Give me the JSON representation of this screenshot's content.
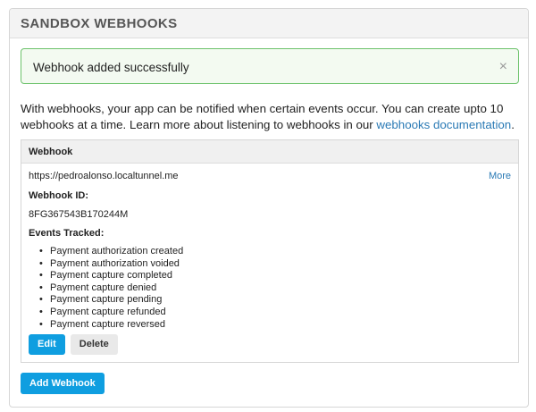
{
  "panel": {
    "title": "SANDBOX WEBHOOKS"
  },
  "alert": {
    "message": "Webhook added successfully",
    "close_glyph": "×"
  },
  "intro": {
    "text": "With webhooks, your app can be notified when certain events occur. You can create upto 10 webhooks at a time. Learn more about listening to webhooks in our ",
    "link_text": "webhooks documentation",
    "after_link": "."
  },
  "table": {
    "header": "Webhook",
    "url": "https://pedroalonso.localtunnel.me",
    "more_label": "More",
    "id_label": "Webhook ID:",
    "id_value": "8FG367543B170244M",
    "events_label": "Events Tracked:",
    "events": [
      "Payment authorization created",
      "Payment authorization voided",
      "Payment capture completed",
      "Payment capture denied",
      "Payment capture pending",
      "Payment capture refunded",
      "Payment capture reversed"
    ],
    "edit_label": "Edit",
    "delete_label": "Delete"
  },
  "actions": {
    "add_label": "Add Webhook"
  },
  "colors": {
    "primary": "#0f9ee0",
    "link": "#2a7ab5",
    "success_border": "#6cc26b",
    "success_bg": "#f3faf1"
  }
}
